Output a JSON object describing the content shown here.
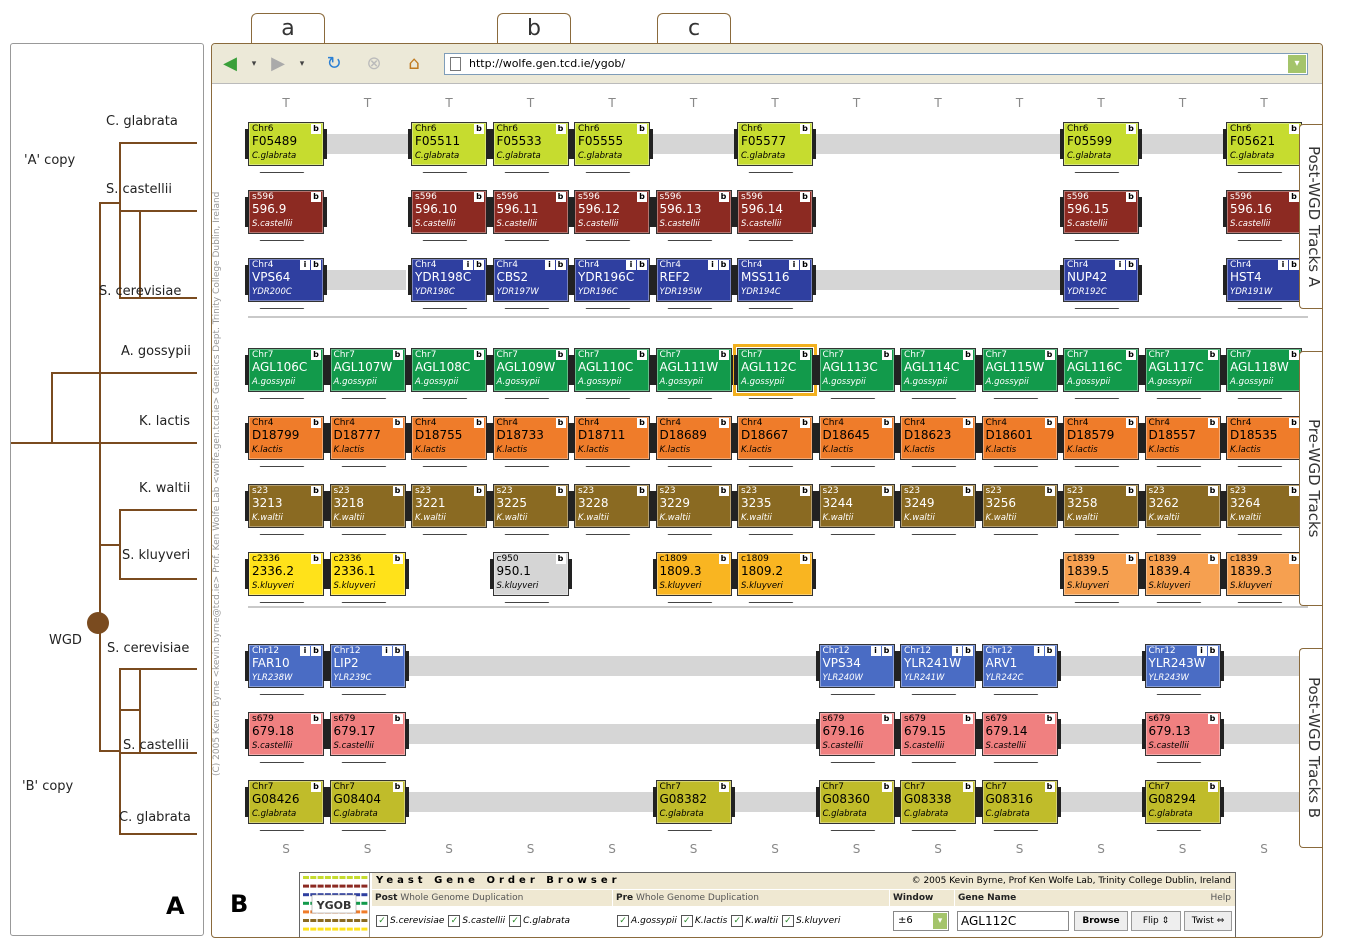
{
  "tabs": [
    "a",
    "b",
    "c"
  ],
  "panel_letters": {
    "tree": "A",
    "browser": "B"
  },
  "tree": {
    "top_copy": "'A' copy",
    "bottom_copy": "'B' copy",
    "wgd": "WGD",
    "species": [
      "C. glabrata",
      "S. castellii",
      "S. cerevisiae",
      "A. gossypii",
      "K. lactis",
      "K. waltii",
      "S. kluyveri",
      "S. cerevisiae",
      "S. castellii",
      "C. glabrata"
    ]
  },
  "browser": {
    "url": "http://wolfe.gen.tcd.ie/ygob/",
    "vertical_credit": "(C) 2005 Kevin Byrne <kevin.byrne@tcd.ie> Prof. Ken Wolfe Lab <wolfe.gen.tcd.ie> Genetics Dept. Trinity College Dublin, Ireland",
    "top_marker": "T",
    "bottom_marker": "S",
    "side_labels": [
      "Post-WGD Tracks A",
      "Pre-WGD Tracks",
      "Post-WGD Tracks B"
    ],
    "colors": {
      "cg": "#c6dc2f",
      "scas": "#8c2a22",
      "scer": "#2f3fa0",
      "ago": "#129a4b",
      "kla": "#ef7c2a",
      "kwa": "#8a6a22",
      "skl_y": "#ffe21a",
      "skl_o": "#f9b521",
      "skl_g": "#d5d5d5",
      "skl_lo": "#f6a050",
      "scer_b": "#4a6cc4",
      "scas_b": "#f08080",
      "cg_b": "#c0bc2a"
    },
    "tracks": [
      {
        "genes": [
          {
            "chr": "Chr6",
            "name": "F05489",
            "sp": "C.glabrata"
          },
          {
            "chr": "Chr6",
            "name": "F05511",
            "sp": "C.glabrata"
          },
          {
            "chr": "Chr6",
            "name": "F05533",
            "sp": "C.glabrata"
          },
          {
            "chr": "Chr6",
            "name": "F05555",
            "sp": "C.glabrata"
          },
          {
            "chr": "Chr6",
            "name": "F05577",
            "sp": "C.glabrata"
          },
          {
            "chr": "Chr6",
            "name": "F05599",
            "sp": "C.glabrata"
          },
          {
            "chr": "Chr6",
            "name": "F05621",
            "sp": "C.glabrata"
          }
        ]
      },
      {
        "genes": [
          {
            "chr": "s596",
            "name": "596.9",
            "sp": "S.castellii"
          },
          {
            "chr": "s596",
            "name": "596.10",
            "sp": "S.castellii"
          },
          {
            "chr": "s596",
            "name": "596.11",
            "sp": "S.castellii"
          },
          {
            "chr": "s596",
            "name": "596.12",
            "sp": "S.castellii"
          },
          {
            "chr": "s596",
            "name": "596.13",
            "sp": "S.castellii"
          },
          {
            "chr": "s596",
            "name": "596.14",
            "sp": "S.castellii"
          },
          {
            "chr": "s596",
            "name": "596.15",
            "sp": "S.castellii"
          },
          {
            "chr": "s596",
            "name": "596.16",
            "sp": "S.castellii"
          }
        ]
      },
      {
        "genes": [
          {
            "chr": "Chr4",
            "name": "VPS64",
            "sp": "YDR200C"
          },
          {
            "chr": "Chr4",
            "name": "YDR198C",
            "sp": "YDR198C"
          },
          {
            "chr": "Chr4",
            "name": "CBS2",
            "sp": "YDR197W"
          },
          {
            "chr": "Chr4",
            "name": "YDR196C",
            "sp": "YDR196C"
          },
          {
            "chr": "Chr4",
            "name": "REF2",
            "sp": "YDR195W"
          },
          {
            "chr": "Chr4",
            "name": "MSS116",
            "sp": "YDR194C"
          },
          {
            "chr": "Chr4",
            "name": "NUP42",
            "sp": "YDR192C"
          },
          {
            "chr": "Chr4",
            "name": "HST4",
            "sp": "YDR191W"
          }
        ]
      },
      {
        "genes": [
          {
            "chr": "Chr7",
            "name": "AGL106C",
            "sp": "A.gossypii"
          },
          {
            "chr": "Chr7",
            "name": "AGL107W",
            "sp": "A.gossypii"
          },
          {
            "chr": "Chr7",
            "name": "AGL108C",
            "sp": "A.gossypii"
          },
          {
            "chr": "Chr7",
            "name": "AGL109W",
            "sp": "A.gossypii"
          },
          {
            "chr": "Chr7",
            "name": "AGL110C",
            "sp": "A.gossypii"
          },
          {
            "chr": "Chr7",
            "name": "AGL111W",
            "sp": "A.gossypii"
          },
          {
            "chr": "Chr7",
            "name": "AGL112C",
            "sp": "A.gossypii"
          },
          {
            "chr": "Chr7",
            "name": "AGL113C",
            "sp": "A.gossypii"
          },
          {
            "chr": "Chr7",
            "name": "AGL114C",
            "sp": "A.gossypii"
          },
          {
            "chr": "Chr7",
            "name": "AGL115W",
            "sp": "A.gossypii"
          },
          {
            "chr": "Chr7",
            "name": "AGL116C",
            "sp": "A.gossypii"
          },
          {
            "chr": "Chr7",
            "name": "AGL117C",
            "sp": "A.gossypii"
          },
          {
            "chr": "Chr7",
            "name": "AGL118W",
            "sp": "A.gossypii"
          }
        ]
      },
      {
        "genes": [
          {
            "chr": "Chr4",
            "name": "D18799",
            "sp": "K.lactis"
          },
          {
            "chr": "Chr4",
            "name": "D18777",
            "sp": "K.lactis"
          },
          {
            "chr": "Chr4",
            "name": "D18755",
            "sp": "K.lactis"
          },
          {
            "chr": "Chr4",
            "name": "D18733",
            "sp": "K.lactis"
          },
          {
            "chr": "Chr4",
            "name": "D18711",
            "sp": "K.lactis"
          },
          {
            "chr": "Chr4",
            "name": "D18689",
            "sp": "K.lactis"
          },
          {
            "chr": "Chr4",
            "name": "D18667",
            "sp": "K.lactis"
          },
          {
            "chr": "Chr4",
            "name": "D18645",
            "sp": "K.lactis"
          },
          {
            "chr": "Chr4",
            "name": "D18623",
            "sp": "K.lactis"
          },
          {
            "chr": "Chr4",
            "name": "D18601",
            "sp": "K.lactis"
          },
          {
            "chr": "Chr4",
            "name": "D18579",
            "sp": "K.lactis"
          },
          {
            "chr": "Chr4",
            "name": "D18557",
            "sp": "K.lactis"
          },
          {
            "chr": "Chr4",
            "name": "D18535",
            "sp": "K.lactis"
          }
        ]
      },
      {
        "genes": [
          {
            "chr": "s23",
            "name": "3213",
            "sp": "K.waltii"
          },
          {
            "chr": "s23",
            "name": "3218",
            "sp": "K.waltii"
          },
          {
            "chr": "s23",
            "name": "3221",
            "sp": "K.waltii"
          },
          {
            "chr": "s23",
            "name": "3225",
            "sp": "K.waltii"
          },
          {
            "chr": "s23",
            "name": "3228",
            "sp": "K.waltii"
          },
          {
            "chr": "s23",
            "name": "3229",
            "sp": "K.waltii"
          },
          {
            "chr": "s23",
            "name": "3235",
            "sp": "K.waltii"
          },
          {
            "chr": "s23",
            "name": "3244",
            "sp": "K.waltii"
          },
          {
            "chr": "s23",
            "name": "3249",
            "sp": "K.waltii"
          },
          {
            "chr": "s23",
            "name": "3256",
            "sp": "K.waltii"
          },
          {
            "chr": "s23",
            "name": "3258",
            "sp": "K.waltii"
          },
          {
            "chr": "s23",
            "name": "3262",
            "sp": "K.waltii"
          },
          {
            "chr": "s23",
            "name": "3264",
            "sp": "K.waltii"
          }
        ]
      },
      {
        "genes": [
          {
            "chr": "c2336",
            "name": "2336.2",
            "sp": "S.kluyveri"
          },
          {
            "chr": "c2336",
            "name": "2336.1",
            "sp": "S.kluyveri"
          },
          {
            "chr": "c950",
            "name": "950.1",
            "sp": "S.kluyveri"
          },
          {
            "chr": "c1809",
            "name": "1809.3",
            "sp": "S.kluyveri"
          },
          {
            "chr": "c1809",
            "name": "1809.2",
            "sp": "S.kluyveri"
          },
          {
            "chr": "c1839",
            "name": "1839.5",
            "sp": "S.kluyveri"
          },
          {
            "chr": "c1839",
            "name": "1839.4",
            "sp": "S.kluyveri"
          },
          {
            "chr": "c1839",
            "name": "1839.3",
            "sp": "S.kluyveri"
          }
        ]
      },
      {
        "genes": [
          {
            "chr": "Chr12",
            "name": "FAR10",
            "sp": "YLR238W"
          },
          {
            "chr": "Chr12",
            "name": "LIP2",
            "sp": "YLR239C"
          },
          {
            "chr": "Chr12",
            "name": "VPS34",
            "sp": "YLR240W"
          },
          {
            "chr": "Chr12",
            "name": "YLR241W",
            "sp": "YLR241W"
          },
          {
            "chr": "Chr12",
            "name": "ARV1",
            "sp": "YLR242C"
          },
          {
            "chr": "Chr12",
            "name": "YLR243W",
            "sp": "YLR243W"
          }
        ]
      },
      {
        "genes": [
          {
            "chr": "s679",
            "name": "679.18",
            "sp": "S.castellii"
          },
          {
            "chr": "s679",
            "name": "679.17",
            "sp": "S.castellii"
          },
          {
            "chr": "s679",
            "name": "679.16",
            "sp": "S.castellii"
          },
          {
            "chr": "s679",
            "name": "679.15",
            "sp": "S.castellii"
          },
          {
            "chr": "s679",
            "name": "679.14",
            "sp": "S.castellii"
          },
          {
            "chr": "s679",
            "name": "679.13",
            "sp": "S.castellii"
          }
        ]
      },
      {
        "genes": [
          {
            "chr": "Chr7",
            "name": "G08426",
            "sp": "C.glabrata"
          },
          {
            "chr": "Chr7",
            "name": "G08404",
            "sp": "C.glabrata"
          },
          {
            "chr": "Chr7",
            "name": "G08382",
            "sp": "C.glabrata"
          },
          {
            "chr": "Chr7",
            "name": "G08360",
            "sp": "C.glabrata"
          },
          {
            "chr": "Chr7",
            "name": "G08338",
            "sp": "C.glabrata"
          },
          {
            "chr": "Chr7",
            "name": "G08316",
            "sp": "C.glabrata"
          },
          {
            "chr": "Chr7",
            "name": "G08294",
            "sp": "C.glabrata"
          }
        ]
      }
    ]
  },
  "footer": {
    "title": "Yeast Gene Order Browser",
    "copyright": "© 2005 Kevin Byrne, Prof Ken Wolfe Lab, Trinity College Dublin, Ireland",
    "post_label": "Post",
    "post_desc": "Whole Genome Duplication",
    "pre_label": "Pre",
    "pre_desc": "Whole Genome Duplication",
    "window_label": "Window",
    "gene_name_label": "Gene Name",
    "help": "Help",
    "post_species": [
      "S.cerevisiae",
      "S.castellii",
      "C.glabrata"
    ],
    "pre_species": [
      "A.gossypii",
      "K.lactis",
      "K.waltii",
      "S.kluyveri"
    ],
    "window_value": "±6",
    "gene_value": "AGL112C",
    "browse": "Browse",
    "flip": "Flip ⇕",
    "twist": "Twist ⇔",
    "logo": "YGOB"
  }
}
